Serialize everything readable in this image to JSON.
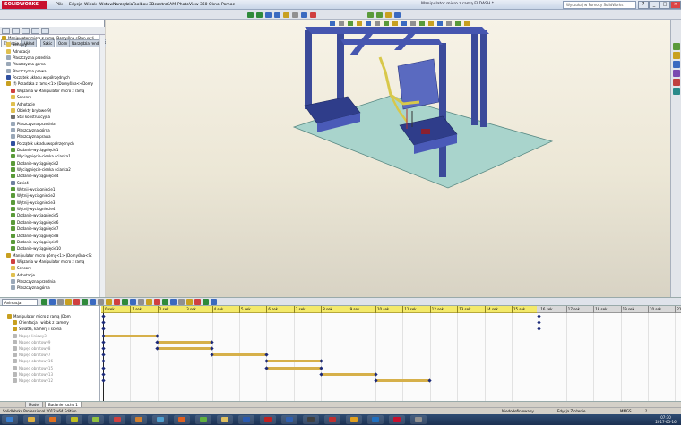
{
  "app": {
    "logo_text": "SOLIDWORKS",
    "menu": [
      "Plik",
      "Edycja",
      "Widok",
      "Wstaw",
      "Narzędzia",
      "Toolbox",
      "3Dcontrol",
      "CAM",
      "PhotoView 360",
      "Okno",
      "Pomoc"
    ],
    "document_title": "Manipulator micro z ramą ELDASH *",
    "help_search_placeholder": "Wyszukaj w Pomocy SolidWorks",
    "window_buttons": [
      "?",
      "_",
      "□",
      "×"
    ]
  },
  "command_tabs": [
    "Złożenie",
    "Układ",
    "Szkic",
    "Ocen",
    "Narzędzia renderowania",
    "Produkty Office",
    "CAM"
  ],
  "feature_tree": [
    {
      "label": "Manipulator micro z ramą  (Domyślna<Stan wyś",
      "color": "#c8a020",
      "indent": 0
    },
    {
      "label": "Sensory",
      "color": "#e0c050",
      "indent": 1
    },
    {
      "label": "Adnotacje",
      "color": "#e0c050",
      "indent": 1
    },
    {
      "label": "Płaszczyzna przednia",
      "color": "#9aa8b8",
      "indent": 1
    },
    {
      "label": "Płaszczyzna górna",
      "color": "#9aa8b8",
      "indent": 1
    },
    {
      "label": "Płaszczyzna prawa",
      "color": "#9aa8b8",
      "indent": 1
    },
    {
      "label": "Początek układu współrzędnych",
      "color": "#3050a0",
      "indent": 1
    },
    {
      "label": "(f) Posadzka z ramą<1> (Domyślna<<Domy",
      "color": "#c8a020",
      "indent": 1
    },
    {
      "label": "Wiązania w Manipulator micro z ramą",
      "color": "#d04040",
      "indent": 2
    },
    {
      "label": "Sensory",
      "color": "#e0c050",
      "indent": 2
    },
    {
      "label": "Adnotacje",
      "color": "#e0c050",
      "indent": 2
    },
    {
      "label": "Obiekty bryłowe(9)",
      "color": "#e0c050",
      "indent": 2
    },
    {
      "label": "Stal konstrukcyjna",
      "color": "#707070",
      "indent": 2
    },
    {
      "label": "Płaszczyzna przednia",
      "color": "#9aa8b8",
      "indent": 2
    },
    {
      "label": "Płaszczyzna górna",
      "color": "#9aa8b8",
      "indent": 2
    },
    {
      "label": "Płaszczyzna prawa",
      "color": "#9aa8b8",
      "indent": 2
    },
    {
      "label": "Początek układu współrzędnych",
      "color": "#3050a0",
      "indent": 2
    },
    {
      "label": "Dodanie-wyciągnięcie1",
      "color": "#5a9a3a",
      "indent": 2
    },
    {
      "label": "Wyciągnięcie-cienka ścianka1",
      "color": "#5a9a3a",
      "indent": 2
    },
    {
      "label": "Dodanie-wyciągnięcie2",
      "color": "#5a9a3a",
      "indent": 2
    },
    {
      "label": "Wyciągnięcie-cienka ścianka2",
      "color": "#5a9a3a",
      "indent": 2
    },
    {
      "label": "Dodanie-wyciągnięcie4",
      "color": "#5a9a3a",
      "indent": 2
    },
    {
      "label": "Szkic4",
      "color": "#7080a0",
      "indent": 2
    },
    {
      "label": "Wytnij-wyciągnięcie1",
      "color": "#5a9a3a",
      "indent": 2
    },
    {
      "label": "Wytnij-wyciągnięcie2",
      "color": "#5a9a3a",
      "indent": 2
    },
    {
      "label": "Wytnij-wyciągnięcie3",
      "color": "#5a9a3a",
      "indent": 2
    },
    {
      "label": "Wytnij-wyciągnięcie4",
      "color": "#5a9a3a",
      "indent": 2
    },
    {
      "label": "Dodanie-wyciągnięcie5",
      "color": "#5a9a3a",
      "indent": 2
    },
    {
      "label": "Dodanie-wyciągnięcie6",
      "color": "#5a9a3a",
      "indent": 2
    },
    {
      "label": "Dodanie-wyciągnięcie7",
      "color": "#5a9a3a",
      "indent": 2
    },
    {
      "label": "Dodanie-wyciągnięcie8",
      "color": "#5a9a3a",
      "indent": 2
    },
    {
      "label": "Dodanie-wyciągnięcie9",
      "color": "#5a9a3a",
      "indent": 2
    },
    {
      "label": "Dodanie-wyciągnięcie10",
      "color": "#5a9a3a",
      "indent": 2
    },
    {
      "label": "Manipulator micro górny<1> (Domyślna<St",
      "color": "#c8a020",
      "indent": 1
    },
    {
      "label": "Wiązania w Manipulator micro z ramą",
      "color": "#d04040",
      "indent": 2
    },
    {
      "label": "Sensory",
      "color": "#e0c050",
      "indent": 2
    },
    {
      "label": "Adnotacje",
      "color": "#e0c050",
      "indent": 2
    },
    {
      "label": "Płaszczyzna przednia",
      "color": "#9aa8b8",
      "indent": 2
    },
    {
      "label": "Płaszczyzna górna",
      "color": "#9aa8b8",
      "indent": 2
    }
  ],
  "motion": {
    "study_type": "Animacja",
    "timeline_tree": [
      {
        "label": "Manipulator micro z ramą  (Dom",
        "dim": false
      },
      {
        "label": "Orientacja i widok z kamery",
        "dim": false
      },
      {
        "label": "Światła, kamery i scena",
        "dim": false
      },
      {
        "label": "Napęd liniowy3",
        "dim": true
      },
      {
        "label": "Napęd obrotowy9",
        "dim": true
      },
      {
        "label": "Napęd obrotowy8",
        "dim": true
      },
      {
        "label": "Napęd obrotowy7",
        "dim": true
      },
      {
        "label": "Napęd obrotowy16",
        "dim": true
      },
      {
        "label": "Napęd obrotowy15",
        "dim": true
      },
      {
        "label": "Napęd obrotowy13",
        "dim": true
      },
      {
        "label": "Napęd obrotowy12",
        "dim": true
      }
    ],
    "ruler_ticks": [
      "0 sek",
      "1 sek",
      "2 sek",
      "3 sek",
      "4 sek",
      "5 sek",
      "6 sek",
      "7 sek",
      "8 sek",
      "9 sek",
      "10 sek",
      "11 sek",
      "12 sek",
      "13 sek",
      "14 sek",
      "15 sek",
      "16 sek",
      "17 sek",
      "18 sek",
      "19 sek",
      "20 sek",
      "21 s"
    ],
    "active_end_sek": 16,
    "tracks": [
      {
        "row": 3,
        "start": 0,
        "end": 2
      },
      {
        "row": 4,
        "start": 2,
        "end": 4
      },
      {
        "row": 5,
        "start": 2,
        "end": 4
      },
      {
        "row": 6,
        "start": 4,
        "end": 6
      },
      {
        "row": 7,
        "start": 6,
        "end": 8
      },
      {
        "row": 8,
        "start": 6,
        "end": 8
      },
      {
        "row": 9,
        "start": 8,
        "end": 10
      },
      {
        "row": 10,
        "start": 10,
        "end": 12
      }
    ]
  },
  "bottom_tabs": [
    "Model",
    "Badanie ruchu 1"
  ],
  "status": {
    "left": "SolidWorks Professional 2012 x64 Edition",
    "state": "Niedodefiniowany",
    "mode": "Edycja Złożenie",
    "units": "MMGS",
    "help": "?"
  },
  "clock": {
    "time": "07:30",
    "date": "2017-05-16"
  },
  "taskbar_icons": [
    {
      "name": "windows-start-icon",
      "color": "#3a7fd0"
    },
    {
      "name": "explorer-icon",
      "color": "#e0b040"
    },
    {
      "name": "media-player-icon",
      "color": "#e07020"
    },
    {
      "name": "app-7-icon",
      "color": "#c0c020"
    },
    {
      "name": "app-z-icon",
      "color": "#90c040"
    },
    {
      "name": "app-k-icon",
      "color": "#d04040"
    },
    {
      "name": "app-f-icon",
      "color": "#d08030"
    },
    {
      "name": "app-globe-icon",
      "color": "#50a0d0"
    },
    {
      "name": "app-matlab-icon",
      "color": "#e06020"
    },
    {
      "name": "app-green-icon",
      "color": "#60b040"
    },
    {
      "name": "app-folder-icon",
      "color": "#e0c060"
    },
    {
      "name": "word-icon",
      "color": "#2a5ab0"
    },
    {
      "name": "app-red-icon",
      "color": "#c02020"
    },
    {
      "name": "app-m-icon",
      "color": "#3060b0"
    },
    {
      "name": "app-dark-icon",
      "color": "#404040"
    },
    {
      "name": "app-w-icon",
      "color": "#c03030"
    },
    {
      "name": "chrome-icon",
      "color": "#e0a020"
    },
    {
      "name": "app-e-icon",
      "color": "#2070c0"
    },
    {
      "name": "solidworks-icon",
      "color": "#c8102e"
    },
    {
      "name": "app-tool-icon",
      "color": "#909090"
    }
  ]
}
